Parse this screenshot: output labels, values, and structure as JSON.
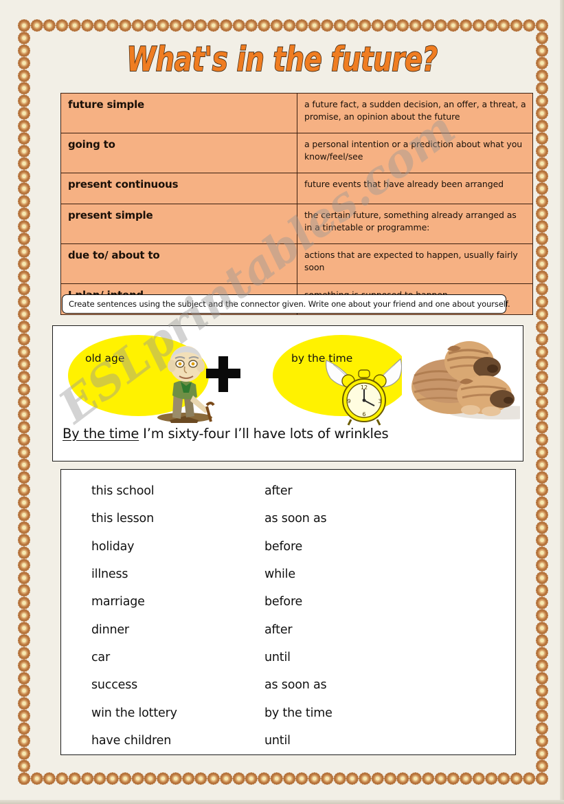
{
  "page": {
    "title": "What's in the future?",
    "background_color": "#f2efe6",
    "border_motif": "flower-rosette"
  },
  "watermark": {
    "text": "ESLprintables.com"
  },
  "forms_table": {
    "rows": [
      {
        "form": "future simple",
        "use": "a future fact, a sudden decision, an offer, a threat, a promise, an opinion about the future"
      },
      {
        "form": "going to",
        "use": "a personal intention or a prediction about what you know/feel/see"
      },
      {
        "form": "present continuous",
        "use": "future events that have already been arranged"
      },
      {
        "form": "present simple",
        "use": "the certain future, something already arranged as in a timetable or programme:"
      },
      {
        "form": "due to/ about to",
        "use": "actions that are expected to happen, usually fairly soon"
      },
      {
        "form": "I plan/ intend",
        "use": "something is supposed to happen"
      }
    ],
    "fill_color": "#f6b183",
    "border_color": "#3b1f10"
  },
  "instruction": {
    "text": "Create sentences using the subject and the connector given. Write one about your friend and one about yourself."
  },
  "example": {
    "bubble_left": "old age",
    "bubble_right": "by the time",
    "plus_symbol": "+",
    "bubble_color": "#fff200",
    "sentence_underlined": "By the time",
    "sentence_rest": " I’m sixty-four I’ll have lots of wrinkles"
  },
  "wordlist": {
    "pairs": [
      {
        "subject": "this school",
        "connector": "after"
      },
      {
        "subject": "this lesson",
        "connector": "as soon as"
      },
      {
        "subject": "holiday",
        "connector": "before"
      },
      {
        "subject": "illness",
        "connector": "while"
      },
      {
        "subject": "marriage",
        "connector": "before"
      },
      {
        "subject": "dinner",
        "connector": "after"
      },
      {
        "subject": "car",
        "connector": "until"
      },
      {
        "subject": "success",
        "connector": "as soon as"
      },
      {
        "subject": "win the lottery",
        "connector": "by the time"
      },
      {
        "subject": "have children",
        "connector": "until"
      }
    ]
  }
}
